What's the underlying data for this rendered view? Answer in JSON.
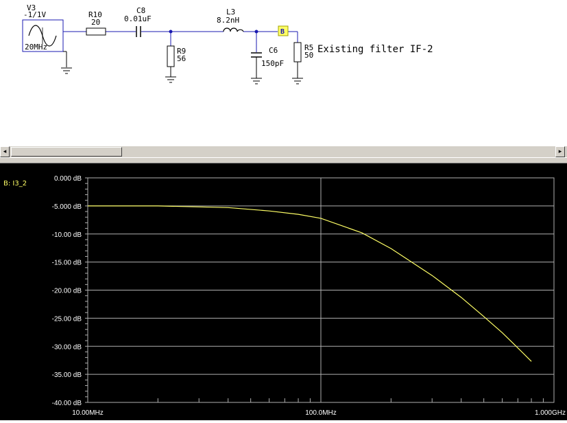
{
  "schematic": {
    "source": {
      "name": "V3",
      "value": "-1/1V",
      "freq": "20MHz"
    },
    "r10": {
      "name": "R10",
      "value": "20"
    },
    "c8": {
      "name": "C8",
      "value": "0.01uF"
    },
    "r9": {
      "name": "R9",
      "value": "56"
    },
    "l3": {
      "name": "L3",
      "value": "8.2nH"
    },
    "c6": {
      "name": "C6",
      "value": "150pF"
    },
    "r5": {
      "name": "R5",
      "value": "50"
    },
    "probe": {
      "label": "B"
    },
    "note": "Existing filter IF-2"
  },
  "scrollbar": {
    "left_arrow": "◂",
    "right_arrow": "▸"
  },
  "colors": {
    "trace": "#ffff66",
    "grid": "#b0b0b0",
    "axis_text": "#ffffff",
    "probe_fill": "#ffff66",
    "wire": "#1a1ab0"
  },
  "chart_data": {
    "type": "line",
    "x_scale": "log",
    "legend": "B: I3_2",
    "xlim": [
      10,
      1000
    ],
    "ylim": [
      -40,
      0
    ],
    "x_ticks": [
      {
        "v": 10,
        "label": "10.00MHz"
      },
      {
        "v": 100,
        "label": "100.0MHz"
      },
      {
        "v": 1000,
        "label": "1.000GHz"
      }
    ],
    "y_ticks": [
      {
        "v": 0,
        "label": "0.000 dB"
      },
      {
        "v": -5,
        "label": "-5.000 dB"
      },
      {
        "v": -10,
        "label": "-10.00 dB"
      },
      {
        "v": -15,
        "label": "-15.00 dB"
      },
      {
        "v": -20,
        "label": "-20.00 dB"
      },
      {
        "v": -25,
        "label": "-25.00 dB"
      },
      {
        "v": -30,
        "label": "-30.00 dB"
      },
      {
        "v": -35,
        "label": "-35.00 dB"
      },
      {
        "v": -40,
        "label": "-40.00 dB"
      }
    ],
    "series": [
      {
        "name": "B: I3_2",
        "x": [
          10,
          20,
          40,
          60,
          80,
          100,
          150,
          200,
          300,
          400,
          500,
          600,
          700,
          800
        ],
        "y": [
          -5.0,
          -5.0,
          -5.3,
          -5.9,
          -6.5,
          -7.2,
          -9.8,
          -12.6,
          -17.4,
          -21.3,
          -24.7,
          -27.6,
          -30.3,
          -32.7
        ]
      }
    ]
  }
}
